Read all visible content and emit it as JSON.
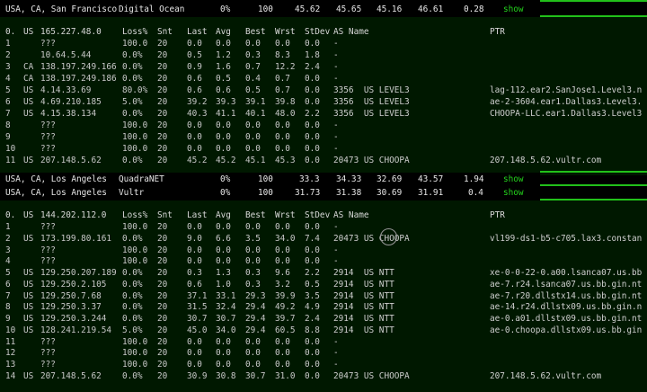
{
  "summaries": [
    {
      "location": "USA, CA, San Francisco",
      "provider": "Digital Ocean",
      "loss": "0%",
      "sent": "100",
      "c1": "45.62",
      "c2": "45.65",
      "c3": "45.16",
      "c4": "46.61",
      "c5": "0.28",
      "action": "show"
    },
    {
      "location": "USA, CA, Los Angeles",
      "provider": "QuadraNET",
      "loss": "0%",
      "sent": "100",
      "c1": "33.3",
      "c2": "34.33",
      "c3": "32.69",
      "c4": "43.57",
      "c5": "1.94",
      "action": "show"
    },
    {
      "location": "USA, CA, Los Angeles",
      "provider": "Vultr",
      "loss": "0%",
      "sent": "100",
      "c1": "31.73",
      "c2": "31.38",
      "c3": "30.69",
      "c4": "31.91",
      "c5": "0.4",
      "action": "show"
    }
  ],
  "traces": [
    {
      "header": {
        "hop": "0.",
        "cc": "US",
        "host": "165.227.48.0",
        "loss": "Loss%",
        "snt": "Snt",
        "last": "Last",
        "avg": "Avg",
        "best": "Best",
        "wrst": "Wrst",
        "stdev": "StDev",
        "asname": "AS Name",
        "ptr": "PTR"
      },
      "rows": [
        {
          "hop": "1",
          "cc": "",
          "host": "???",
          "loss": "100.0",
          "snt": "20",
          "last": "0.0",
          "avg": "0.0",
          "best": "0.0",
          "wrst": "0.0",
          "stdev": "0.0",
          "asname": "-",
          "ptr": ""
        },
        {
          "hop": "2",
          "cc": "",
          "host": "10.64.5.44",
          "loss": "0.0%",
          "snt": "20",
          "last": "0.5",
          "avg": "1.2",
          "best": "0.3",
          "wrst": "8.3",
          "stdev": "1.8",
          "asname": "-",
          "ptr": ""
        },
        {
          "hop": "3",
          "cc": "CA",
          "host": "138.197.249.166",
          "loss": "0.0%",
          "snt": "20",
          "last": "0.9",
          "avg": "1.6",
          "best": "0.7",
          "wrst": "12.2",
          "stdev": "2.4",
          "asname": "-",
          "ptr": ""
        },
        {
          "hop": "4",
          "cc": "CA",
          "host": "138.197.249.186",
          "loss": "0.0%",
          "snt": "20",
          "last": "0.6",
          "avg": "0.5",
          "best": "0.4",
          "wrst": "0.7",
          "stdev": "0.0",
          "asname": "-",
          "ptr": ""
        },
        {
          "hop": "5",
          "cc": "US",
          "host": "4.14.33.69",
          "loss": "80.0%",
          "snt": "20",
          "last": "0.6",
          "avg": "0.6",
          "best": "0.5",
          "wrst": "0.7",
          "stdev": "0.0",
          "asname": "3356  US LEVEL3",
          "ptr": "lag-112.ear2.SanJose1.Level3.n"
        },
        {
          "hop": "6",
          "cc": "US",
          "host": "4.69.210.185",
          "loss": "5.0%",
          "snt": "20",
          "last": "39.2",
          "avg": "39.3",
          "best": "39.1",
          "wrst": "39.8",
          "stdev": "0.0",
          "asname": "3356  US LEVEL3",
          "ptr": "ae-2-3604.ear1.Dallas3.Level3."
        },
        {
          "hop": "7",
          "cc": "US",
          "host": "4.15.38.134",
          "loss": "0.0%",
          "snt": "20",
          "last": "40.3",
          "avg": "41.1",
          "best": "40.1",
          "wrst": "48.0",
          "stdev": "2.2",
          "asname": "3356  US LEVEL3",
          "ptr": "CHOOPA-LLC.ear1.Dallas3.Level3"
        },
        {
          "hop": "8",
          "cc": "",
          "host": "???",
          "loss": "100.0",
          "snt": "20",
          "last": "0.0",
          "avg": "0.0",
          "best": "0.0",
          "wrst": "0.0",
          "stdev": "0.0",
          "asname": "-",
          "ptr": ""
        },
        {
          "hop": "9",
          "cc": "",
          "host": "???",
          "loss": "100.0",
          "snt": "20",
          "last": "0.0",
          "avg": "0.0",
          "best": "0.0",
          "wrst": "0.0",
          "stdev": "0.0",
          "asname": "-",
          "ptr": ""
        },
        {
          "hop": "10",
          "cc": "",
          "host": "???",
          "loss": "100.0",
          "snt": "20",
          "last": "0.0",
          "avg": "0.0",
          "best": "0.0",
          "wrst": "0.0",
          "stdev": "0.0",
          "asname": "-",
          "ptr": ""
        },
        {
          "hop": "11",
          "cc": "US",
          "host": "207.148.5.62",
          "loss": "0.0%",
          "snt": "20",
          "last": "45.2",
          "avg": "45.2",
          "best": "45.1",
          "wrst": "45.3",
          "stdev": "0.0",
          "asname": "20473 US CHOOPA",
          "ptr": "207.148.5.62.vultr.com"
        }
      ]
    },
    {
      "header": {
        "hop": "0.",
        "cc": "US",
        "host": "144.202.112.0",
        "loss": "Loss%",
        "snt": "Snt",
        "last": "Last",
        "avg": "Avg",
        "best": "Best",
        "wrst": "Wrst",
        "stdev": "StDev",
        "asname": "AS Name",
        "ptr": "PTR"
      },
      "rows": [
        {
          "hop": "1",
          "cc": "",
          "host": "???",
          "loss": "100.0",
          "snt": "20",
          "last": "0.0",
          "avg": "0.0",
          "best": "0.0",
          "wrst": "0.0",
          "stdev": "0.0",
          "asname": "-",
          "ptr": ""
        },
        {
          "hop": "2",
          "cc": "US",
          "host": "173.199.80.161",
          "loss": "0.0%",
          "snt": "20",
          "last": "9.0",
          "avg": "6.6",
          "best": "3.5",
          "wrst": "34.0",
          "stdev": "7.4",
          "asname": "20473 US CHOOPA",
          "ptr": "vl199-ds1-b5-c705.lax3.constan"
        },
        {
          "hop": "3",
          "cc": "",
          "host": "???",
          "loss": "100.0",
          "snt": "20",
          "last": "0.0",
          "avg": "0.0",
          "best": "0.0",
          "wrst": "0.0",
          "stdev": "0.0",
          "asname": "-",
          "ptr": ""
        },
        {
          "hop": "4",
          "cc": "",
          "host": "???",
          "loss": "100.0",
          "snt": "20",
          "last": "0.0",
          "avg": "0.0",
          "best": "0.0",
          "wrst": "0.0",
          "stdev": "0.0",
          "asname": "-",
          "ptr": ""
        },
        {
          "hop": "5",
          "cc": "US",
          "host": "129.250.207.189",
          "loss": "0.0%",
          "snt": "20",
          "last": "0.3",
          "avg": "1.3",
          "best": "0.3",
          "wrst": "9.6",
          "stdev": "2.2",
          "asname": "2914  US NTT",
          "ptr": "xe-0-0-22-0.a00.lsanca07.us.bb"
        },
        {
          "hop": "6",
          "cc": "US",
          "host": "129.250.2.105",
          "loss": "0.0%",
          "snt": "20",
          "last": "0.6",
          "avg": "1.0",
          "best": "0.3",
          "wrst": "3.2",
          "stdev": "0.5",
          "asname": "2914  US NTT",
          "ptr": "ae-7.r24.lsanca07.us.bb.gin.nt"
        },
        {
          "hop": "7",
          "cc": "US",
          "host": "129.250.7.68",
          "loss": "0.0%",
          "snt": "20",
          "last": "37.1",
          "avg": "33.1",
          "best": "29.3",
          "wrst": "39.9",
          "stdev": "3.5",
          "asname": "2914  US NTT",
          "ptr": "ae-7.r20.dllstx14.us.bb.gin.nt"
        },
        {
          "hop": "8",
          "cc": "US",
          "host": "129.250.3.37",
          "loss": "0.0%",
          "snt": "20",
          "last": "31.5",
          "avg": "32.4",
          "best": "29.4",
          "wrst": "49.2",
          "stdev": "4.9",
          "asname": "2914  US NTT",
          "ptr": "ae-14.r24.dllstx09.us.bb.gin.n"
        },
        {
          "hop": "9",
          "cc": "US",
          "host": "129.250.3.244",
          "loss": "0.0%",
          "snt": "20",
          "last": "30.7",
          "avg": "30.7",
          "best": "29.4",
          "wrst": "39.7",
          "stdev": "2.4",
          "asname": "2914  US NTT",
          "ptr": "ae-0.a01.dllstx09.us.bb.gin.nt"
        },
        {
          "hop": "10",
          "cc": "US",
          "host": "128.241.219.54",
          "loss": "5.0%",
          "snt": "20",
          "last": "45.0",
          "avg": "34.0",
          "best": "29.4",
          "wrst": "60.5",
          "stdev": "8.8",
          "asname": "2914  US NTT",
          "ptr": "ae-0.choopa.dllstx09.us.bb.gin"
        },
        {
          "hop": "11",
          "cc": "",
          "host": "???",
          "loss": "100.0",
          "snt": "20",
          "last": "0.0",
          "avg": "0.0",
          "best": "0.0",
          "wrst": "0.0",
          "stdev": "0.0",
          "asname": "-",
          "ptr": ""
        },
        {
          "hop": "12",
          "cc": "",
          "host": "???",
          "loss": "100.0",
          "snt": "20",
          "last": "0.0",
          "avg": "0.0",
          "best": "0.0",
          "wrst": "0.0",
          "stdev": "0.0",
          "asname": "-",
          "ptr": ""
        },
        {
          "hop": "13",
          "cc": "",
          "host": "???",
          "loss": "100.0",
          "snt": "20",
          "last": "0.0",
          "avg": "0.0",
          "best": "0.0",
          "wrst": "0.0",
          "stdev": "0.0",
          "asname": "-",
          "ptr": ""
        },
        {
          "hop": "14",
          "cc": "US",
          "host": "207.148.5.62",
          "loss": "0.0%",
          "snt": "20",
          "last": "30.9",
          "avg": "30.8",
          "best": "30.7",
          "wrst": "31.0",
          "stdev": "0.0",
          "asname": "20473 US CHOOPA",
          "ptr": "207.148.5.62.vultr.com"
        }
      ]
    }
  ]
}
